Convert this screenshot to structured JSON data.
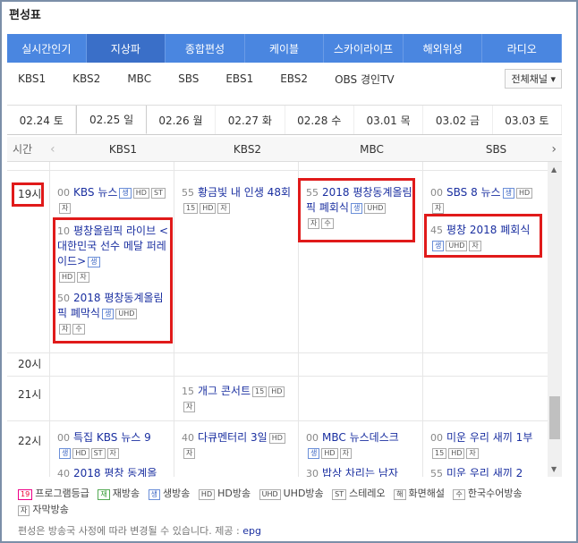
{
  "page_title": "편성표",
  "top_tabs": [
    {
      "label": "실시간인기",
      "active": false
    },
    {
      "label": "지상파",
      "active": true
    },
    {
      "label": "종합편성",
      "active": false
    },
    {
      "label": "케이블",
      "active": false
    },
    {
      "label": "스카이라이프",
      "active": false
    },
    {
      "label": "해외위성",
      "active": false
    },
    {
      "label": "라디오",
      "active": false
    }
  ],
  "channels": [
    "KBS1",
    "KBS2",
    "MBC",
    "SBS",
    "EBS1",
    "EBS2",
    "OBS 경인TV"
  ],
  "all_channels_label": "전체채널",
  "dates": [
    {
      "label": "02.24 토",
      "active": false
    },
    {
      "label": "02.25 일",
      "active": true
    },
    {
      "label": "02.26 월",
      "active": false
    },
    {
      "label": "02.27 화",
      "active": false
    },
    {
      "label": "02.28 수",
      "active": false
    },
    {
      "label": "03.01 목",
      "active": false
    },
    {
      "label": "03.02 금",
      "active": false
    },
    {
      "label": "03.03 토",
      "active": false
    }
  ],
  "grid_header": {
    "time_label": "시간",
    "columns": [
      "KBS1",
      "KBS2",
      "MBC",
      "SBS"
    ]
  },
  "hours": [
    "19시",
    "20시",
    "21시",
    "22시"
  ],
  "programs": {
    "p1": {
      "min": "00",
      "title": "KBS 뉴스"
    },
    "p2": {
      "min": "10",
      "title": "평창올림픽 라이브 <대한민국 선수 메달 퍼레이드>"
    },
    "p3": {
      "min": "50",
      "title": "2018 평창동계올림픽 폐막식"
    },
    "p4": {
      "min": "55",
      "title": "황금빛 내 인생 48회"
    },
    "p5": {
      "min": "55",
      "title": "2018 평창동계올림픽 폐회식"
    },
    "p6": {
      "min": "00",
      "title": "SBS 8 뉴스"
    },
    "p7": {
      "min": "45",
      "title": "평창 2018 폐회식"
    },
    "p8": {
      "min": "15",
      "title": "개그 콘서트"
    },
    "p9": {
      "min": "00",
      "title": "특집 KBS 뉴스 9"
    },
    "p10": {
      "min": "40",
      "title": "다큐멘터리 3일"
    },
    "p11": {
      "min": "00",
      "title": "MBC 뉴스데스크"
    },
    "p12": {
      "min": "00",
      "title": "미운 우리 새끼 1부"
    },
    "p13": {
      "min": "40",
      "title": "2018 평창 동계올"
    },
    "p14": {
      "min": "30",
      "title": "밥상 차리는 남자"
    },
    "p15": {
      "min": "55",
      "title": "미운 우리 새끼 2"
    }
  },
  "badges": {
    "live": "생",
    "hd": "HD",
    "st": "ST",
    "sub": "자",
    "sign": "수",
    "uhd": "UHD",
    "age15": "15"
  },
  "legend": {
    "age": "프로그램등급",
    "age_badge": "19",
    "re": "재방송",
    "re_badge": "재",
    "live": "생방송",
    "live_badge": "생",
    "hd": "HD방송",
    "hd_badge": "HD",
    "uhd": "UHD방송",
    "uhd_badge": "UHD",
    "stereo": "스테레오",
    "stereo_badge": "ST",
    "desc": "화면해설",
    "desc_badge": "해",
    "sign": "한국수어방송",
    "sign_badge": "수",
    "subtitle": "자막방송",
    "subtitle_badge": "자"
  },
  "footer_note": "편성은 방송국 사정에 따라 변경될 수 있습니다.",
  "footer_source_label": "제공 :",
  "footer_source": "epg"
}
